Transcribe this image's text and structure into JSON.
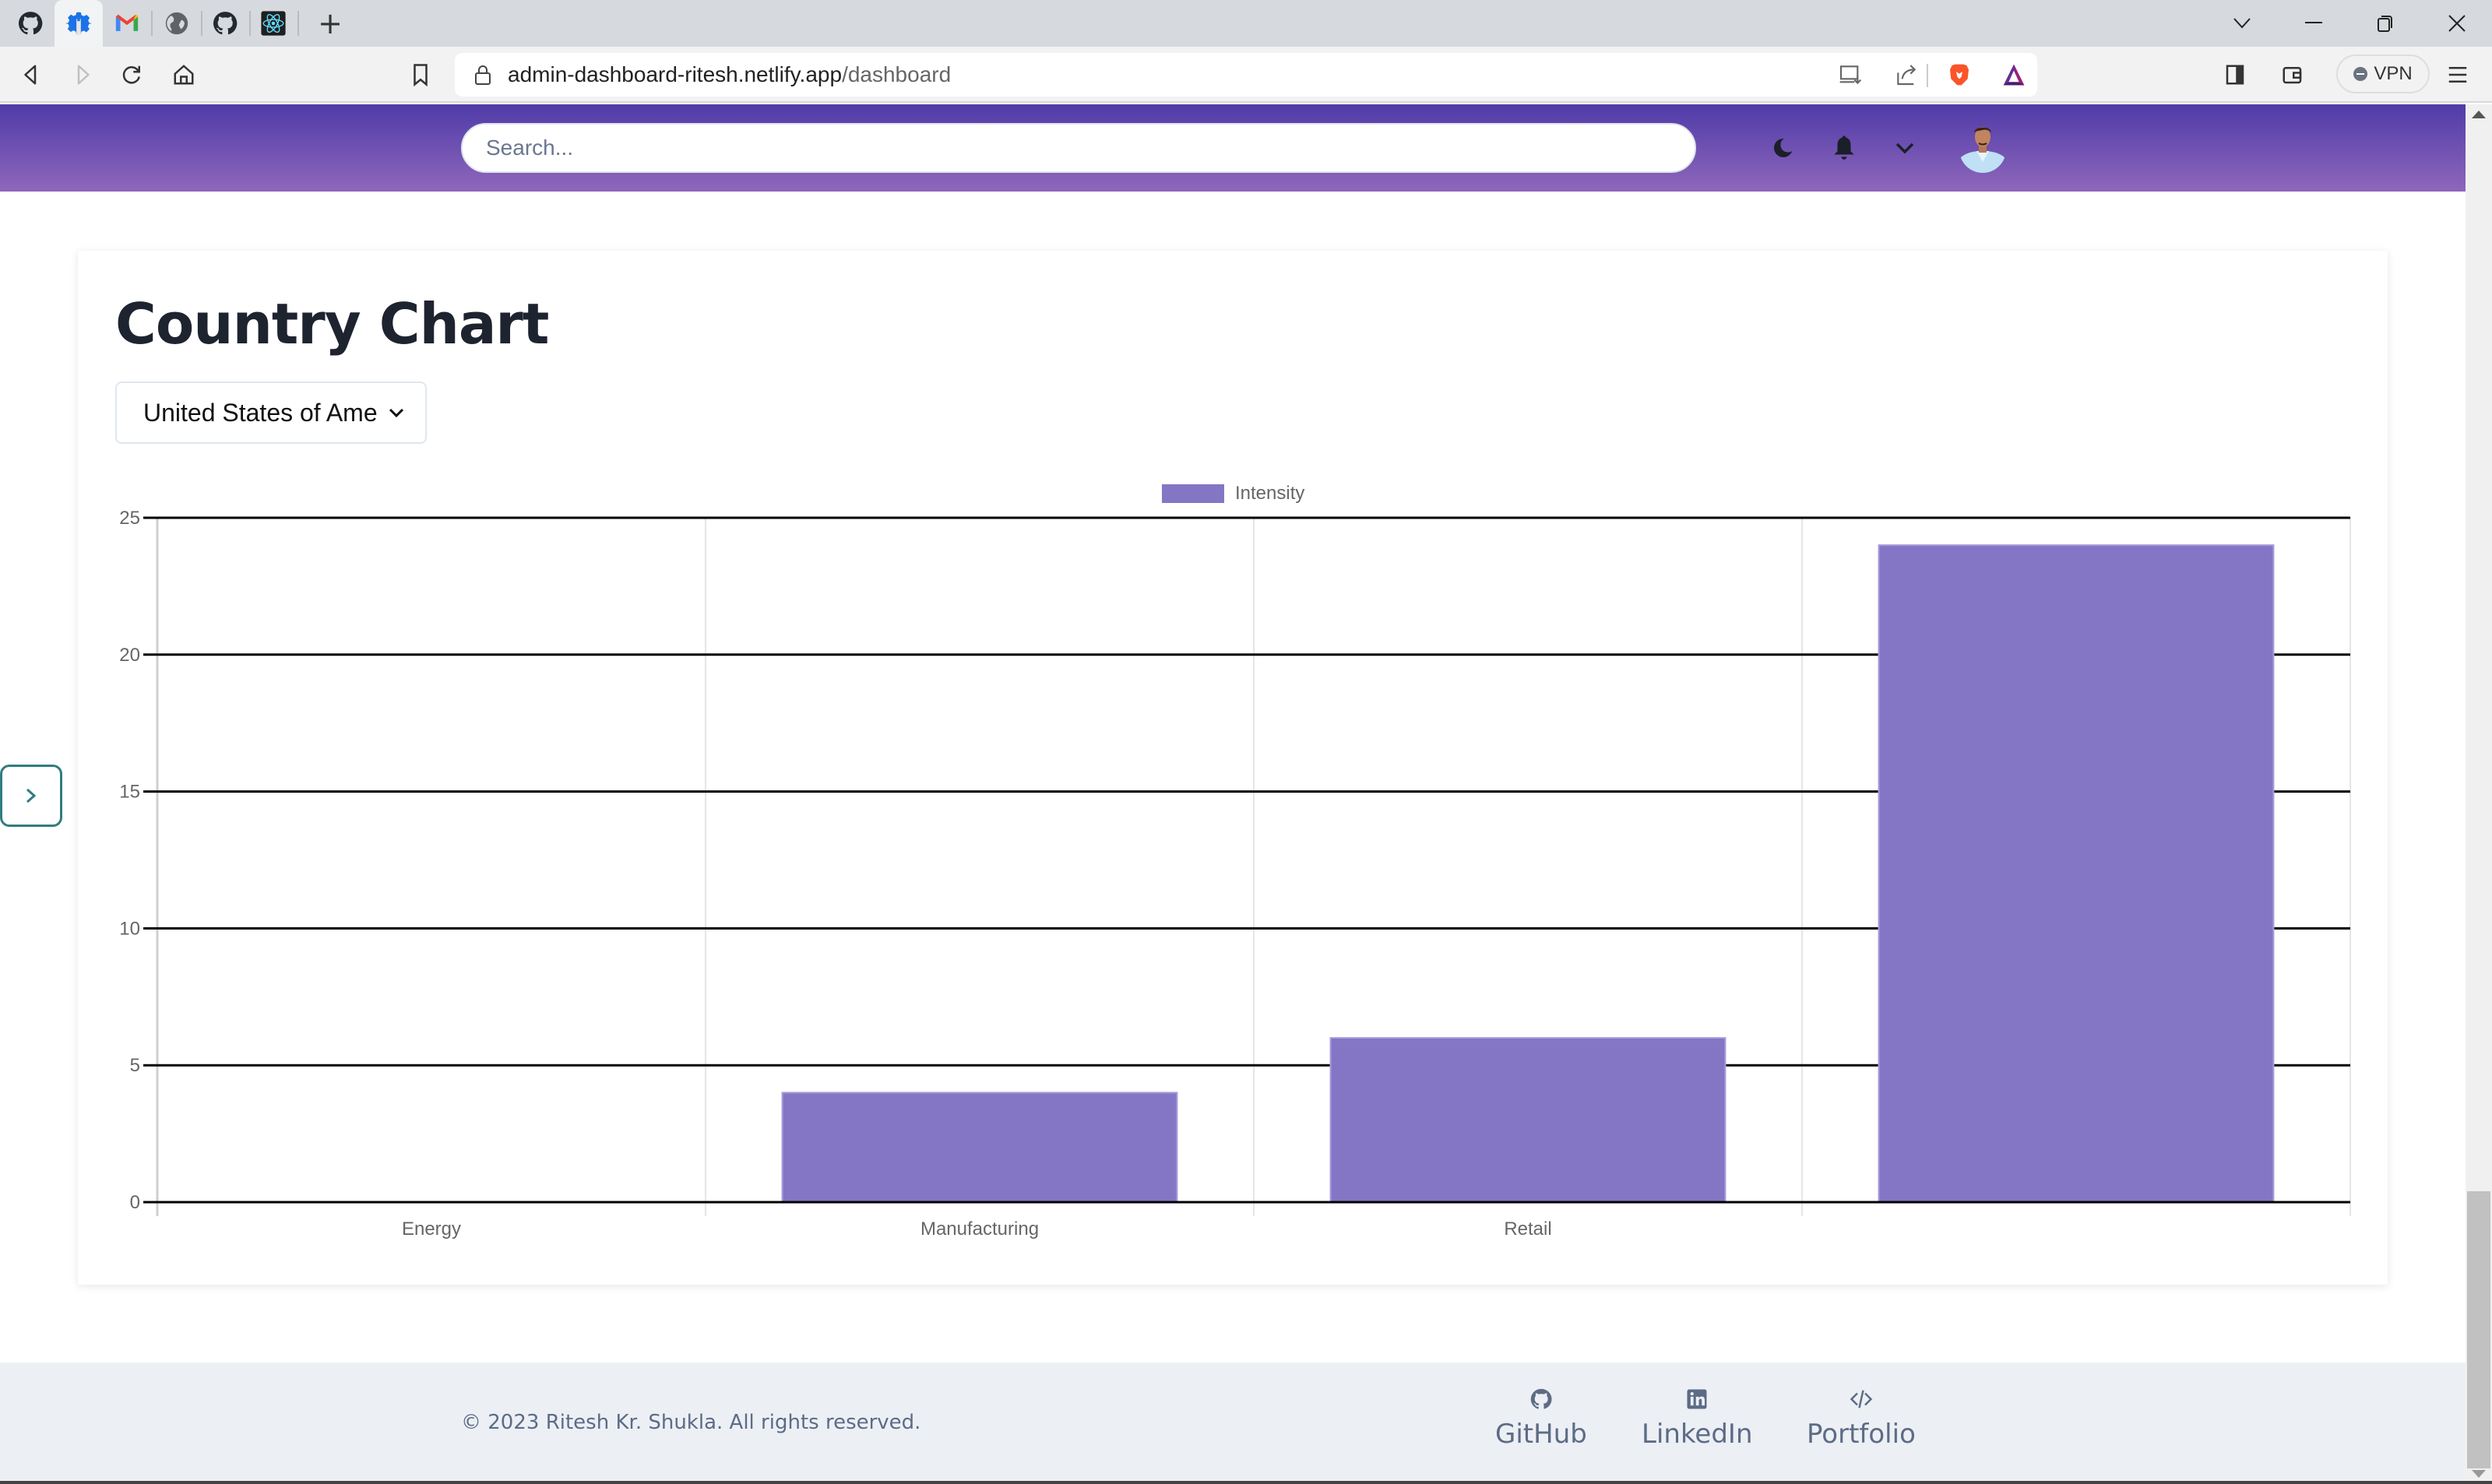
{
  "browser": {
    "tabs": [
      {
        "icon": "github-icon"
      },
      {
        "icon": "settings-wrench-icon",
        "active": true
      },
      {
        "icon": "gmail-icon"
      },
      {
        "icon": "globe-icon"
      },
      {
        "icon": "github-icon"
      },
      {
        "icon": "react-icon"
      }
    ],
    "new_tab_label": "+",
    "url_host": "admin-dashboard-ritesh.netlify.app",
    "url_path": "/dashboard",
    "vpn_label": "VPN"
  },
  "navbar": {
    "search_placeholder": "Search...",
    "search_value": "",
    "icons": [
      "moon-icon",
      "bell-icon",
      "chevron-down-icon",
      "avatar"
    ]
  },
  "card": {
    "title": "Country Chart",
    "country_select": {
      "selected": "United States of Ame"
    }
  },
  "chart_data": {
    "type": "bar",
    "title": "",
    "categories": [
      "Energy",
      "Manufacturing",
      "Retail",
      ""
    ],
    "series": [
      {
        "name": "Intensity",
        "values": [
          0,
          4,
          6,
          24
        ],
        "color": "#8476c4"
      }
    ],
    "xlabel": "",
    "ylabel": "",
    "ylim": [
      0,
      25
    ],
    "yticks": [
      0,
      5,
      10,
      15,
      20,
      25
    ],
    "grid": true,
    "legend": "top-center"
  },
  "footer": {
    "copyright": "© 2023 Ritesh Kr. Shukla. All rights reserved.",
    "links": [
      {
        "label": "GitHub",
        "icon": "github-icon"
      },
      {
        "label": "LinkedIn",
        "icon": "linkedin-icon"
      },
      {
        "label": "Portfolio",
        "icon": "code-icon"
      }
    ]
  },
  "colors": {
    "navbar_gradient_top": "#4f3ba8",
    "navbar_gradient_bottom": "#8f67bb",
    "bar": "#8476c4",
    "footer_bg": "#ecf0f5",
    "footer_text": "#5d6b85",
    "toggle_accent": "#2f7d80"
  }
}
